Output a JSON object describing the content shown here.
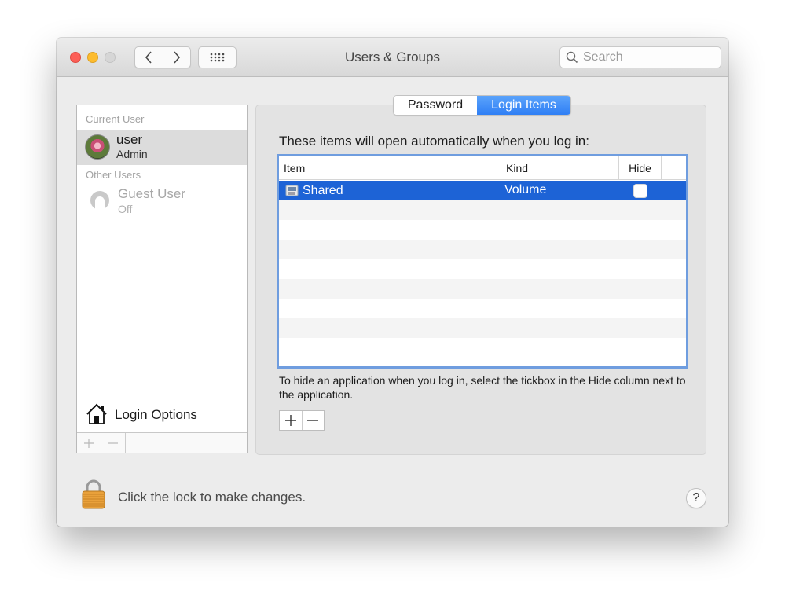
{
  "window": {
    "title": "Users & Groups"
  },
  "search": {
    "placeholder": "Search"
  },
  "sidebar": {
    "current_label": "Current User",
    "current_user": {
      "name": "user",
      "role": "Admin"
    },
    "other_label": "Other Users",
    "other_users": [
      {
        "name": "Guest User",
        "status": "Off"
      }
    ],
    "login_options": "Login Options"
  },
  "tabs": [
    {
      "label": "Password",
      "selected": false
    },
    {
      "label": "Login Items",
      "selected": true
    }
  ],
  "login_items": {
    "intro": "These items will open automatically when you log in:",
    "columns": [
      "Item",
      "Kind",
      "Hide"
    ],
    "rows": [
      {
        "item": "Shared",
        "kind": "Volume",
        "hide": false,
        "selected": true
      }
    ],
    "hint": "To hide an application when you log in, select the tickbox in the Hide column next to the application."
  },
  "footer": {
    "lock_text": "Click the lock to make changes.",
    "help_label": "?"
  },
  "colors": {
    "selection": "#1d63d6",
    "tab_selected": "#2f7ff5",
    "close": "#fc5f57",
    "minimize": "#fdbc2e",
    "table_focus": "#6f9ddf"
  },
  "icons": {
    "back": "chevron-left-icon",
    "forward": "chevron-right-icon",
    "show_all": "grid-icon",
    "search": "magnifier-icon",
    "home": "house-icon",
    "volume": "drive-icon",
    "lock": "padlock-icon"
  }
}
